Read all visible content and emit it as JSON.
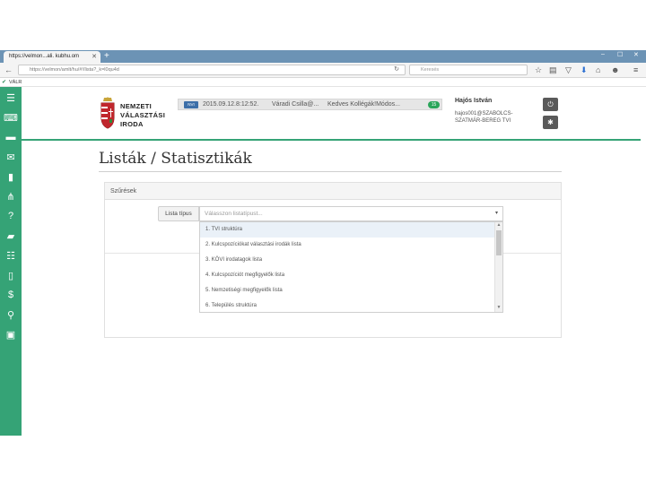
{
  "browser": {
    "tab_title": "https://velmon...ali. kubhu.om",
    "tab_close": "✕",
    "new_tab": "+",
    "url": "https://velmon/amlt/hu/#!/lista?_k=l0qu4d",
    "search_placeholder": "Keresés",
    "bookmark": "VÁLR",
    "window_controls": [
      "–",
      "☐",
      "✕"
    ]
  },
  "sidebar": {
    "items": [
      {
        "icon": "menu-icon",
        "glyph": "☰"
      },
      {
        "icon": "monitor-icon",
        "glyph": "⌨"
      },
      {
        "icon": "chat-icon",
        "glyph": "▬"
      },
      {
        "icon": "envelope-icon",
        "glyph": "✉"
      },
      {
        "icon": "document-icon",
        "glyph": "▮"
      },
      {
        "icon": "sitemap-icon",
        "glyph": "⋔"
      },
      {
        "icon": "question-icon",
        "glyph": "?"
      },
      {
        "icon": "briefcase-icon",
        "glyph": "▰"
      },
      {
        "icon": "list-icon",
        "glyph": "☷"
      },
      {
        "icon": "book-icon",
        "glyph": "▯"
      },
      {
        "icon": "dollar-icon",
        "glyph": "$"
      },
      {
        "icon": "search-icon",
        "glyph": "⚲"
      },
      {
        "icon": "table-icon",
        "glyph": "▣"
      }
    ]
  },
  "header": {
    "org_line1": "NEMZETI",
    "org_line2": "VÁLASZTÁSI",
    "org_line3": "IRODA",
    "ticker_badge": "NVI",
    "ticker_date": "2015.09.12.8:12:52.",
    "ticker_sender": "Váradi Csilla@...",
    "ticker_message": "Kedves Kollégák!Módos...",
    "ticker_count": "15",
    "user_name": "Hajós István",
    "user_email": "hajos001@SZABOLCS-",
    "user_office": "SZATMÁR-BEREG TVI",
    "power_glyph": "⏻",
    "settings_glyph": "✱"
  },
  "page": {
    "title": "Listák / Statisztikák",
    "panel_title": "Szűrések",
    "field_label": "Lista típus",
    "select_placeholder": "Válasszon listatípust...",
    "select_caret": "▾",
    "options": [
      "1. TVI struktúra",
      "2. Kulcspozíciókat választási irodák lista",
      "3. KÖVI irodatagok lista",
      "4. Kulcspozíciót megfigyelők lista",
      "5. Nemzetiségi megfigyelők lista",
      "6. Település struktúra"
    ],
    "active_option_index": 0
  }
}
